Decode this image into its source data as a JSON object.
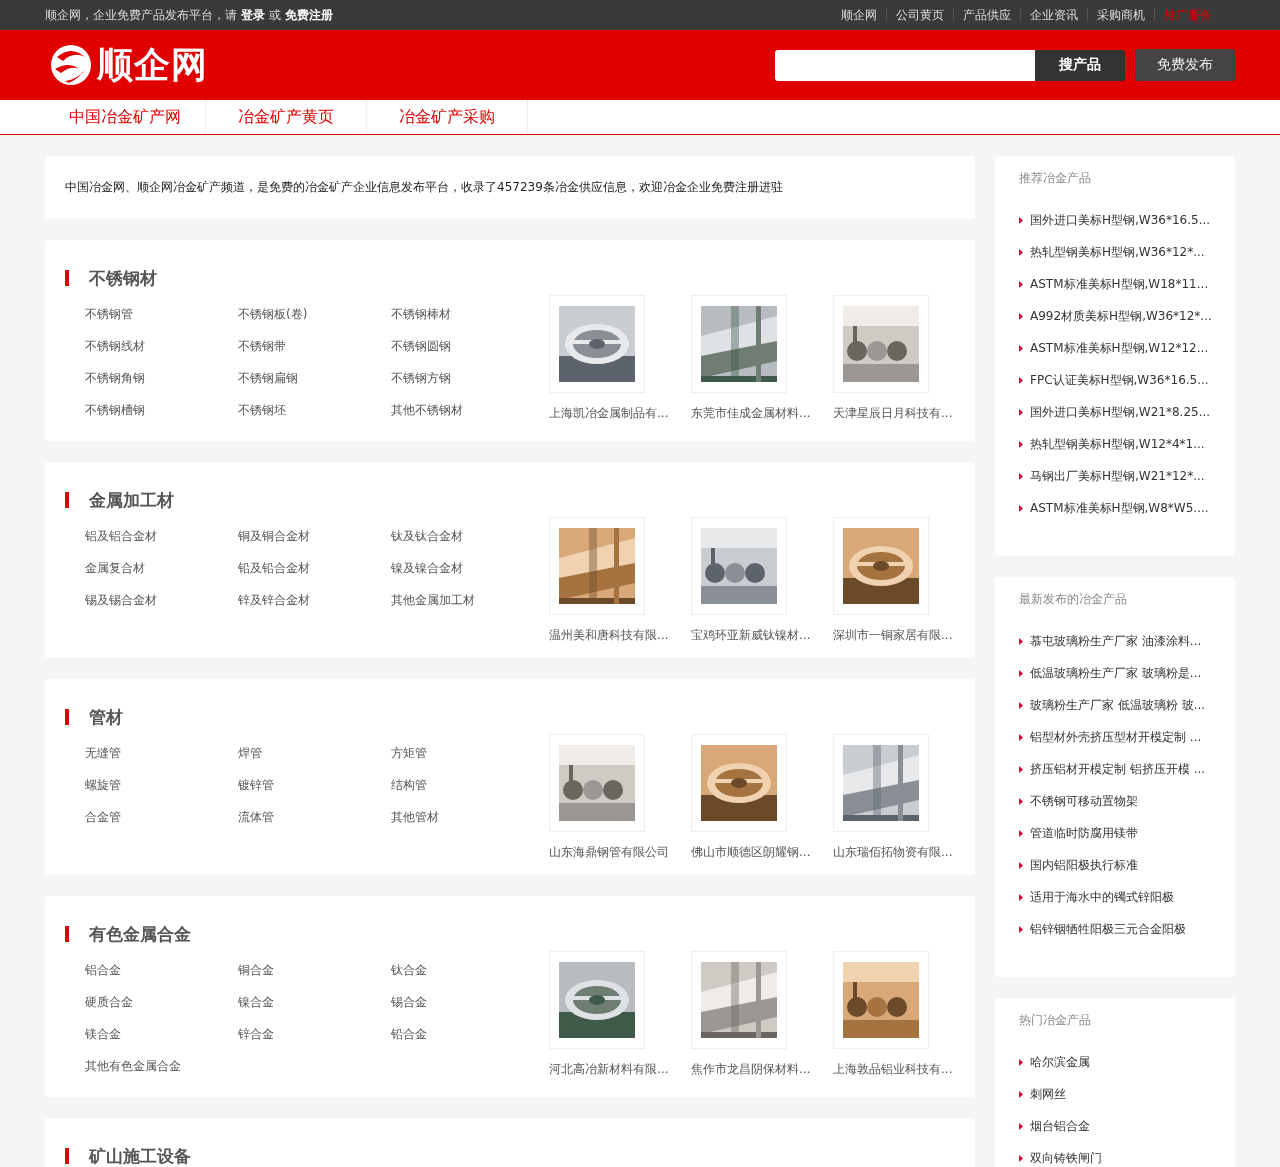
{
  "top_bar": {
    "welcome": "顺企网，企业免费产品发布平台，请",
    "login": "登录",
    "or": "或",
    "register": "免费注册",
    "links": [
      {
        "label": "顺企网",
        "highlighted": false
      },
      {
        "label": "公司黄页",
        "highlighted": false
      },
      {
        "label": "产品供应",
        "highlighted": false
      },
      {
        "label": "企业资讯",
        "highlighted": false
      },
      {
        "label": "采购商机",
        "highlighted": false
      },
      {
        "label": "推广服务",
        "highlighted": true
      }
    ]
  },
  "header": {
    "logo": "顺企网",
    "search_button": "搜产品",
    "publish_button": "免费发布"
  },
  "nav": [
    "中国冶金矿产网",
    "冶金矿产黄页",
    "冶金矿产采购"
  ],
  "intro": "中国冶金网、顺企网冶金矿产频道，是免费的冶金矿产企业信息发布平台，收录了457239条冶金供应信息，欢迎冶金企业免费注册进驻",
  "sections": [
    {
      "title": "不锈钢材",
      "links": [
        "不锈钢管",
        "不锈钢板(卷)",
        "不锈钢棒材",
        "不锈钢线材",
        "不锈钢带",
        "不锈钢圆钢",
        "不锈钢角钢",
        "不锈钢扁钢",
        "不锈钢方钢",
        "不锈钢槽钢",
        "不锈钢坯",
        "其他不锈钢材"
      ],
      "products": [
        {
          "company": "上海凯冶金属制品有..."
        },
        {
          "company": "东莞市佳成金属材料..."
        },
        {
          "company": "天津星辰日月科技有..."
        }
      ]
    },
    {
      "title": "金属加工材",
      "links": [
        "铝及铝合金材",
        "铜及铜合金材",
        "钛及钛合金材",
        "金属复合材",
        "铅及铅合金材",
        "镍及镍合金材",
        "锡及锡合金材",
        "锌及锌合金材",
        "其他金属加工材"
      ],
      "products": [
        {
          "company": "温州美和唐科技有限..."
        },
        {
          "company": "宝鸡环亚新威钛镍材..."
        },
        {
          "company": "深圳市一铜家居有限..."
        }
      ]
    },
    {
      "title": "管材",
      "links": [
        "无缝管",
        "焊管",
        "方矩管",
        "螺旋管",
        "镀锌管",
        "结构管",
        "合金管",
        "流体管",
        "其他管材"
      ],
      "products": [
        {
          "company": "山东海鼎钢管有限公司"
        },
        {
          "company": "佛山市顺德区朗耀钢..."
        },
        {
          "company": "山东瑞佰拓物资有限..."
        }
      ]
    },
    {
      "title": "有色金属合金",
      "links": [
        "铝合金",
        "铜合金",
        "钛合金",
        "硬质合金",
        "镍合金",
        "锡合金",
        "镁合金",
        "锌合金",
        "铅合金",
        "其他有色金属合金"
      ],
      "products": [
        {
          "company": "河北高冶新材料有限..."
        },
        {
          "company": "焦作市龙昌阴保材料..."
        },
        {
          "company": "上海敦品铝业科技有..."
        }
      ]
    },
    {
      "title": "矿山施工设备"
    }
  ],
  "sidebar": [
    {
      "title": "推荐冶金产品",
      "items": [
        "国外进口美标H型钢,W36*16.5...",
        "热轧型钢美标H型钢,W36*12*...",
        "ASTM标准美标H型钢,W18*11...",
        "A992材质美标H型钢,W36*12*...",
        "ASTM标准美标H型钢,W12*12...",
        "FPC认证美标H型钢,W36*16.5...",
        "国外进口美标H型钢,W21*8.25...",
        "热轧型钢美标H型钢,W12*4*1...",
        "马钢出厂美标H型钢,W21*12*...",
        "ASTM标准美标H型钢,W8*W5...."
      ]
    },
    {
      "title": "最新发布的冶金产品",
      "items": [
        "慕屯玻璃粉生产厂家 油漆涂料...",
        "低温玻璃粉生产厂家 玻璃粉是...",
        "玻璃粉生产厂家 低温玻璃粉 玻...",
        "铝型材外壳挤压型材开模定制 ...",
        "挤压铝材开模定制 铝挤压开模 ...",
        "不锈钢可移动置物架",
        "管道临时防腐用镁带",
        "国内铝阳极执行标准",
        "适用于海水中的镯式锌阳极",
        "铝锌铟牺牲阳极三元合金阳极"
      ]
    },
    {
      "title": "热门冶金产品",
      "items": [
        "哈尔滨金属",
        "刺网丝",
        "烟台铝合金",
        "双向铸铁闸门"
      ]
    }
  ]
}
